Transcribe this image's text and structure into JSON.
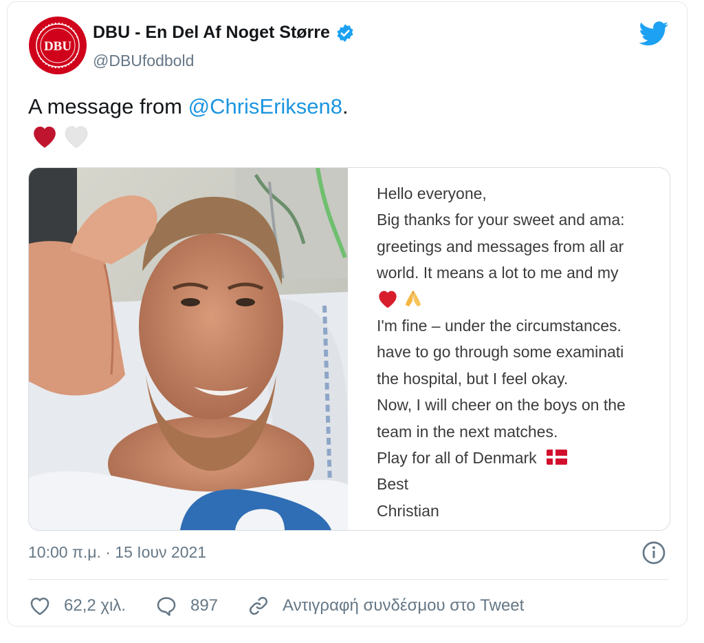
{
  "author": {
    "name": "DBU - En Del Af Noget Større",
    "handle": "@DBUfodbold",
    "avatar_logo_text": "DBU",
    "avatar_ring_text": "DANSK BOLDSPIL-UNION 1889",
    "verified": true,
    "brand_color": "#c8102e"
  },
  "tweet": {
    "text_before": "A message from ",
    "mention": "@ChrisEriksen8",
    "text_after": ".",
    "emojis": [
      "red-heart",
      "white-heart"
    ]
  },
  "media": {
    "photo_icon": "selfie-thumbs-up-photo",
    "letter_lines": [
      "Hello everyone,",
      "Big thanks for your sweet and ama:",
      "greetings and messages from all ar",
      "world. It means a lot to me and my",
      "",
      "I'm fine – under the circumstances.",
      "have to go through some examinati",
      "the hospital, but I feel okay.",
      "Now, I will cheer on the boys on the",
      "team in the next matches.",
      "Play for all of Denmark",
      "Best",
      "Christian"
    ],
    "letter_emojis": [
      "red-heart",
      "folded-hands"
    ],
    "flag_icon": "denmark-flag"
  },
  "meta": {
    "timestamp": "10:00 π.μ. · 15 Ιουν 2021"
  },
  "actions": {
    "likes": "62,2 χιλ.",
    "replies": "897",
    "copy_link": "Αντιγραφή συνδέσμου στο Tweet"
  },
  "colors": {
    "accent": "#1b95e0",
    "muted": "#657786",
    "heart_red": "#c8102e"
  }
}
